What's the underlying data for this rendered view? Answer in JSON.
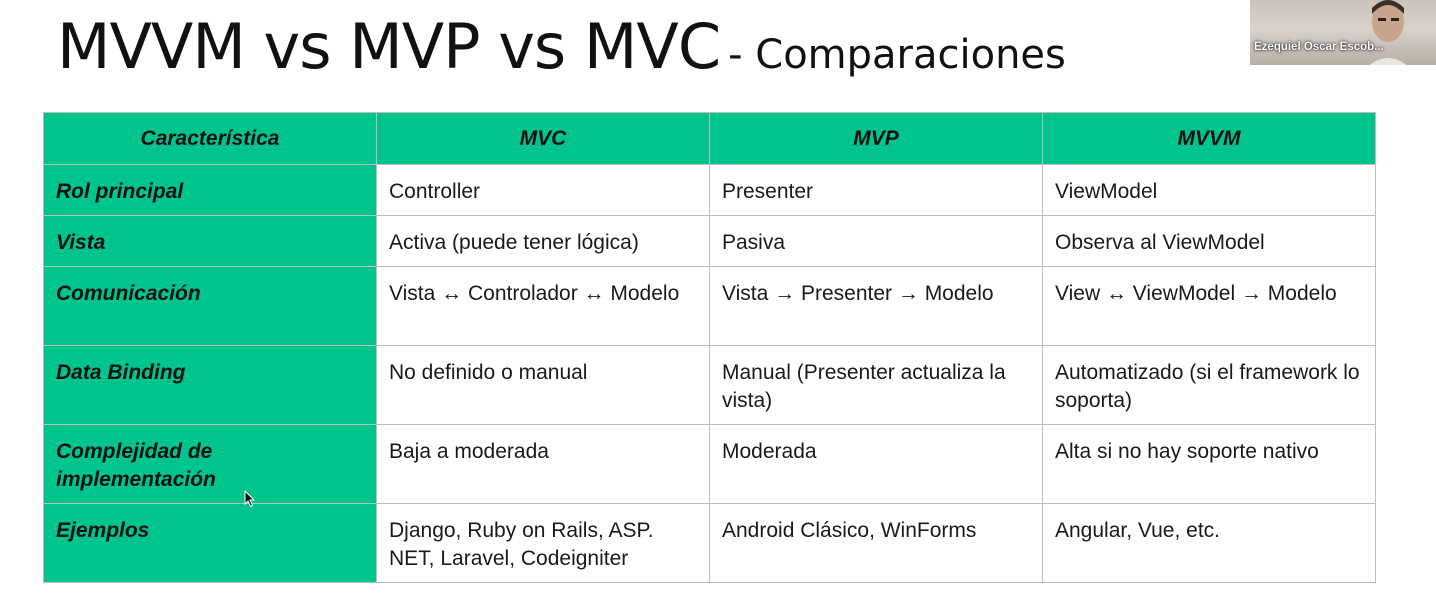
{
  "slide": {
    "title_main": "MVVM vs MVP vs MVC",
    "title_sub": "- Comparaciones"
  },
  "table": {
    "headers": [
      "Característica",
      "MVC",
      "MVP",
      "MVVM"
    ],
    "rows": [
      [
        "Rol principal",
        "Controller",
        "Presenter",
        "ViewModel"
      ],
      [
        "Vista",
        "Activa (puede tener lógica)",
        "Pasiva",
        "Observa al ViewModel"
      ],
      [
        "Comunicación",
        "Vista ↔ Controlador ↔ Modelo",
        "Vista → Presenter → Modelo",
        "View ↔ ViewModel → Modelo"
      ],
      [
        "Data Binding",
        "No definido o manual",
        "Manual (Presenter actualiza la vista)",
        "Automatizado (si el framework lo soporta)"
      ],
      [
        "Complejidad de implementación",
        "Baja a moderada",
        "Moderada",
        "Alta si no hay soporte nativo"
      ],
      [
        "Ejemplos",
        "Django, Ruby on Rails, ASP. NET, Laravel, Codeigniter",
        "Android Clásico, WinForms",
        "Angular, Vue, etc."
      ]
    ]
  },
  "participant": {
    "name": "Ezequiel Oscar Escob..."
  },
  "colors": {
    "accent_green": "#00c48e",
    "border": "#bdbdbd"
  },
  "icons": {
    "cursor": "mouse-pointer-icon"
  }
}
